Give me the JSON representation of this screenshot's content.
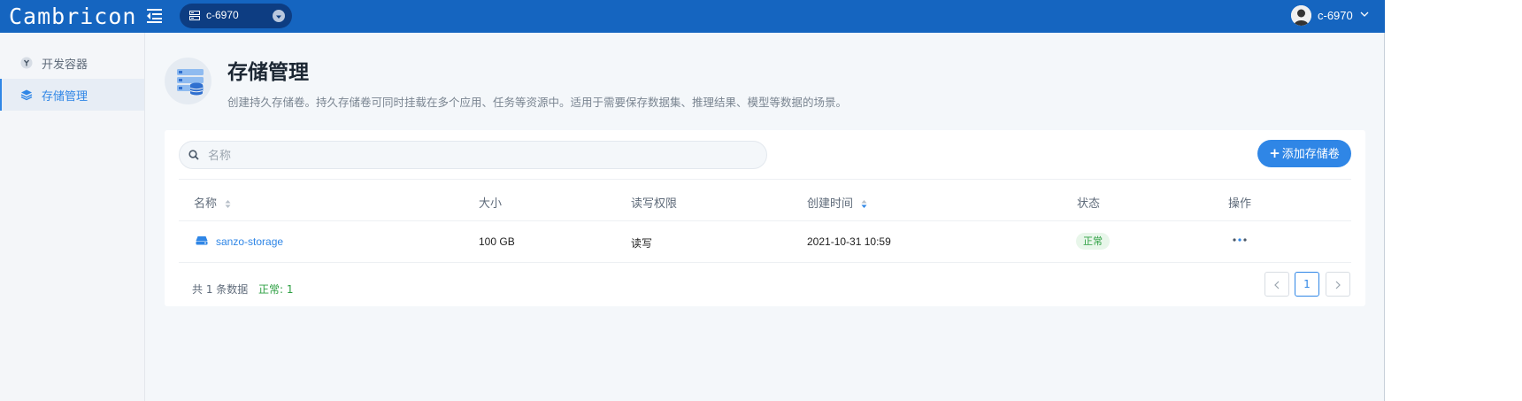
{
  "app": {
    "logo_text": "Cambricon"
  },
  "context": {
    "label": "c-6970"
  },
  "user": {
    "name": "c-6970"
  },
  "sidebar": {
    "items": [
      {
        "label": "开发容器",
        "icon": "container-icon",
        "active": false
      },
      {
        "label": "存储管理",
        "icon": "storage-icon",
        "active": true
      }
    ]
  },
  "page": {
    "title": "存储管理",
    "description": "创建持久存储卷。持久存储卷可同时挂载在多个应用、任务等资源中。适用于需要保存数据集、推理结果、模型等数据的场景。"
  },
  "search": {
    "placeholder": "名称"
  },
  "toolbar": {
    "add_label": "添加存储卷"
  },
  "table": {
    "columns": [
      "名称",
      "大小",
      "读写权限",
      "创建时间",
      "状态",
      "操作"
    ],
    "rows": [
      {
        "name": "sanzo-storage",
        "size": "100 GB",
        "permission": "读写",
        "created": "2021-10-31 10:59",
        "status": "正常"
      }
    ]
  },
  "footer": {
    "total": "共 1 条数据",
    "ok": "正常: 1"
  },
  "pagination": {
    "current": "1"
  },
  "colors": {
    "topbar": "#1565c0",
    "accent": "#2f86e6",
    "success": "#2ea043"
  }
}
